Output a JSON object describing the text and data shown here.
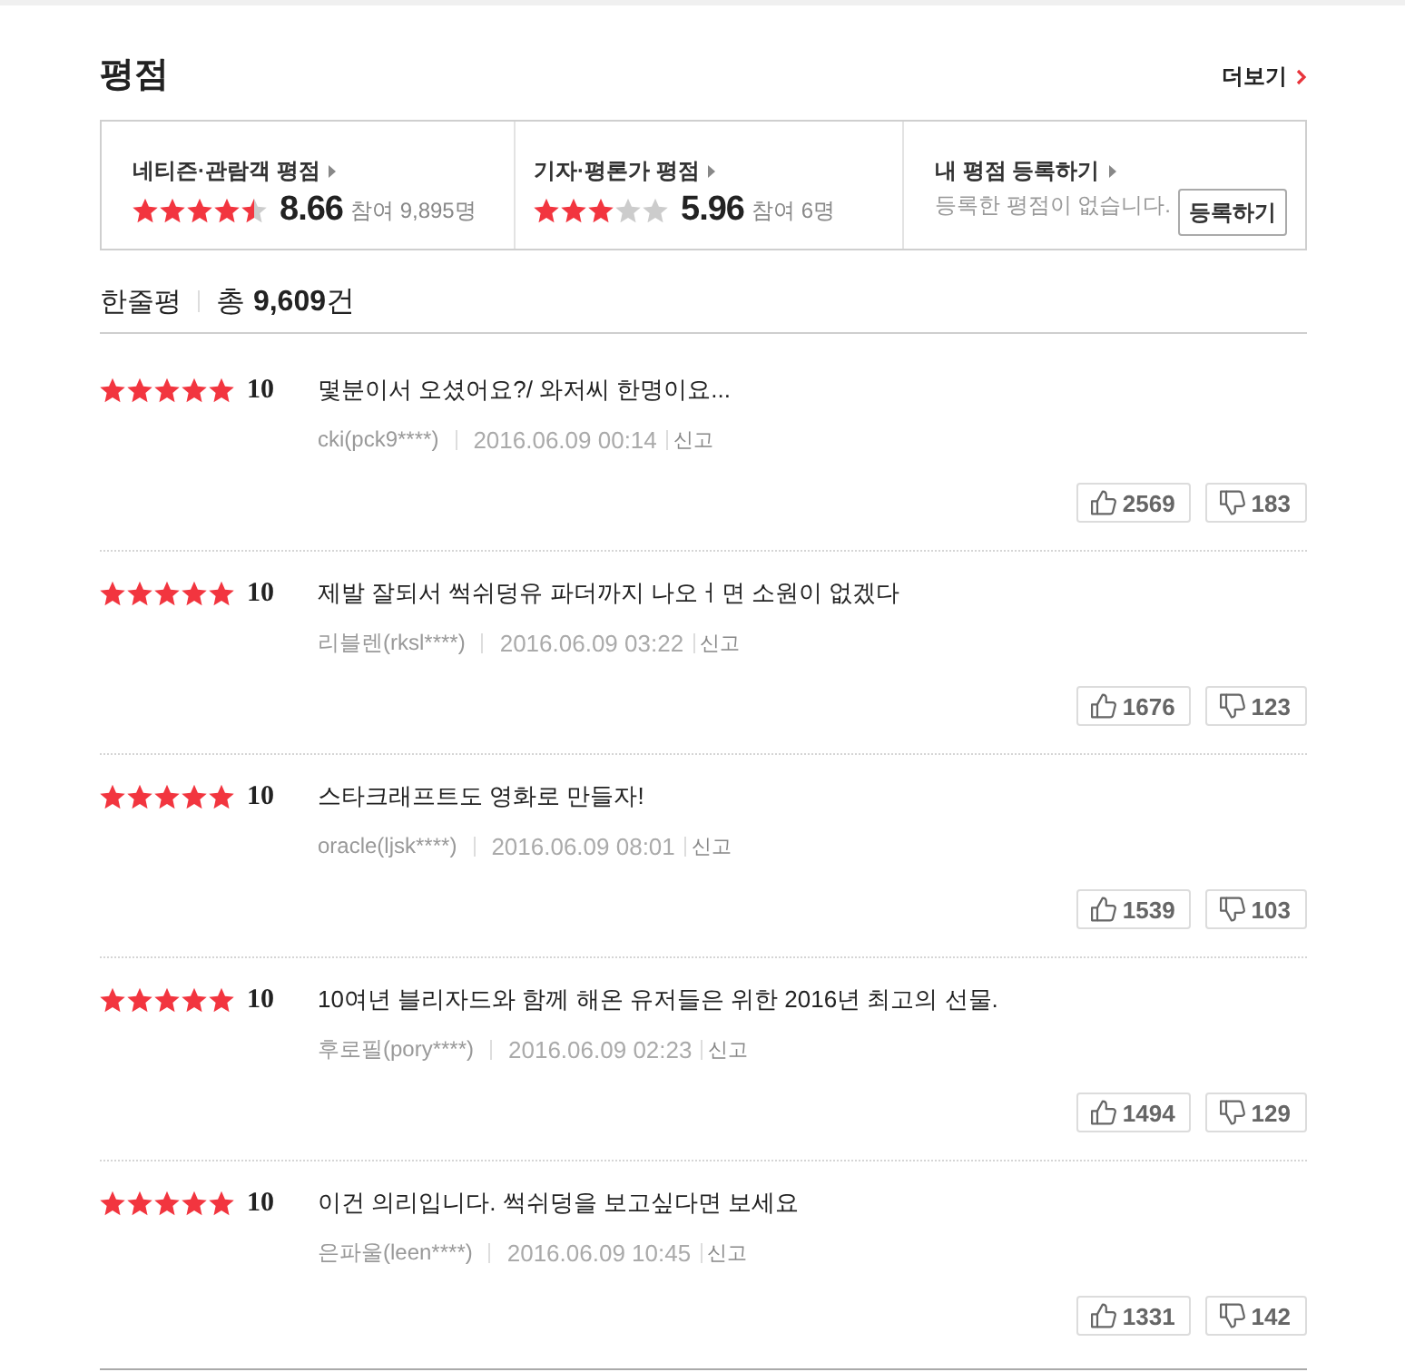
{
  "section": {
    "title": "평점",
    "more_link": "더보기"
  },
  "rating_summary": [
    {
      "kind": "score",
      "label": "네티즌·관람객 평점",
      "stars": 4.5,
      "score": "8.66",
      "participants": "참여 9,895명"
    },
    {
      "kind": "score",
      "label": "기자·평론가 평점",
      "stars": 3,
      "score": "5.96",
      "participants": "참여 6명"
    },
    {
      "kind": "register",
      "label": "내 평점 등록하기",
      "message": "등록한 평점이 없습니다.",
      "button": "등록하기"
    }
  ],
  "reviews_header": {
    "title": "한줄평",
    "total": "총 **9,609**건"
  },
  "reviews": [
    {
      "stars": 5,
      "score": "10",
      "text": "몇분이서 오셨어요?/ 와저씨 한명이요...",
      "author": "cki(pck9****)",
      "date": "2016.06.09 00:14",
      "report": "신고",
      "likes": "2569",
      "dislikes": "183"
    },
    {
      "stars": 5,
      "score": "10",
      "text": "제발 잘되서 썩쉬덩유 파더까지 나오ㅓ면 소원이 없겠다",
      "author": "리블렌(rksl****)",
      "date": "2016.06.09 03:22",
      "report": "신고",
      "likes": "1676",
      "dislikes": "123"
    },
    {
      "stars": 5,
      "score": "10",
      "text": "스타크래프트도 영화로 만들자!",
      "author": "oracle(ljsk****)",
      "date": "2016.06.09 08:01",
      "report": "신고",
      "likes": "1539",
      "dislikes": "103"
    },
    {
      "stars": 5,
      "score": "10",
      "text": "10여년 블리자드와 함께 해온 유저들은 위한 2016년 최고의 선물.",
      "author": "후로필(pory****)",
      "date": "2016.06.09 02:23",
      "report": "신고",
      "likes": "1494",
      "dislikes": "129"
    },
    {
      "stars": 5,
      "score": "10",
      "text": "이건 의리입니다. 썩쉬덩을 보고싶다면 보세요",
      "author": "은파울(leen****)",
      "date": "2016.06.09 10:45",
      "report": "신고",
      "likes": "1331",
      "dislikes": "142"
    }
  ]
}
